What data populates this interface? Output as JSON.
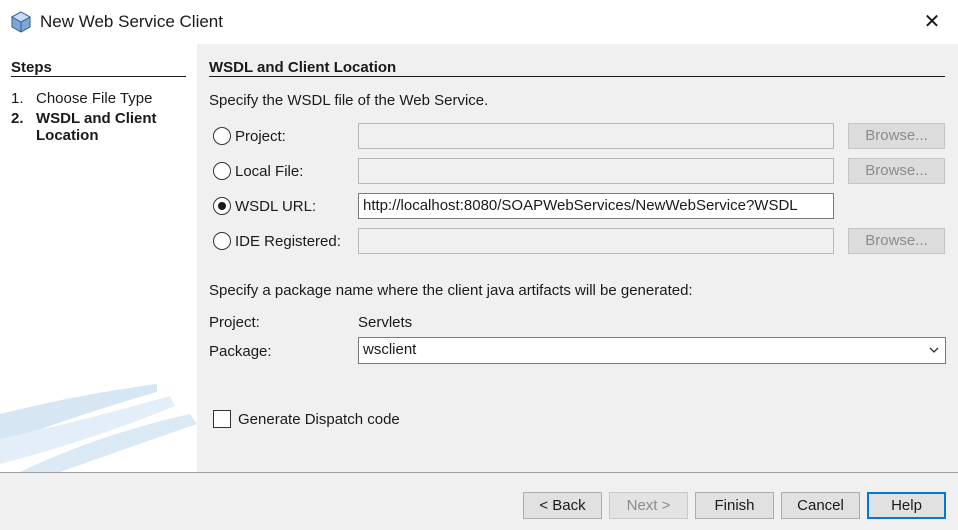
{
  "window": {
    "title": "New Web Service Client",
    "icon": "netbeans-cube-icon",
    "close_glyph": "✕"
  },
  "steps": {
    "title": "Steps",
    "items": [
      {
        "num": "1.",
        "label": "Choose File Type",
        "current": false
      },
      {
        "num": "2.",
        "label": "WSDL and Client Location",
        "current": true
      }
    ]
  },
  "main": {
    "title": "WSDL and Client Location",
    "wsdl_desc": "Specify the WSDL file of the Web Service.",
    "sources": [
      {
        "label": "Project:",
        "value": "",
        "selected": false,
        "browse": "Browse..."
      },
      {
        "label": "Local File:",
        "value": "",
        "selected": false,
        "browse": "Browse..."
      },
      {
        "label": "WSDL URL:",
        "value": "http://localhost:8080/SOAPWebServices/NewWebService?WSDL",
        "selected": true
      },
      {
        "label": "IDE Registered:",
        "value": "",
        "selected": false,
        "browse": "Browse..."
      }
    ],
    "package_desc": "Specify a package name where the client java artifacts will be generated:",
    "project_label": "Project:",
    "project_value": "Servlets",
    "package_label": "Package:",
    "package_value": "wsclient",
    "dispatch_label": "Generate Dispatch code",
    "dispatch_checked": false
  },
  "buttons": {
    "back": "< Back",
    "next": "Next >",
    "finish": "Finish",
    "cancel": "Cancel",
    "help": "Help"
  },
  "colors": {
    "accent": "#0078d7",
    "panel_bg": "#f0f0f0"
  }
}
